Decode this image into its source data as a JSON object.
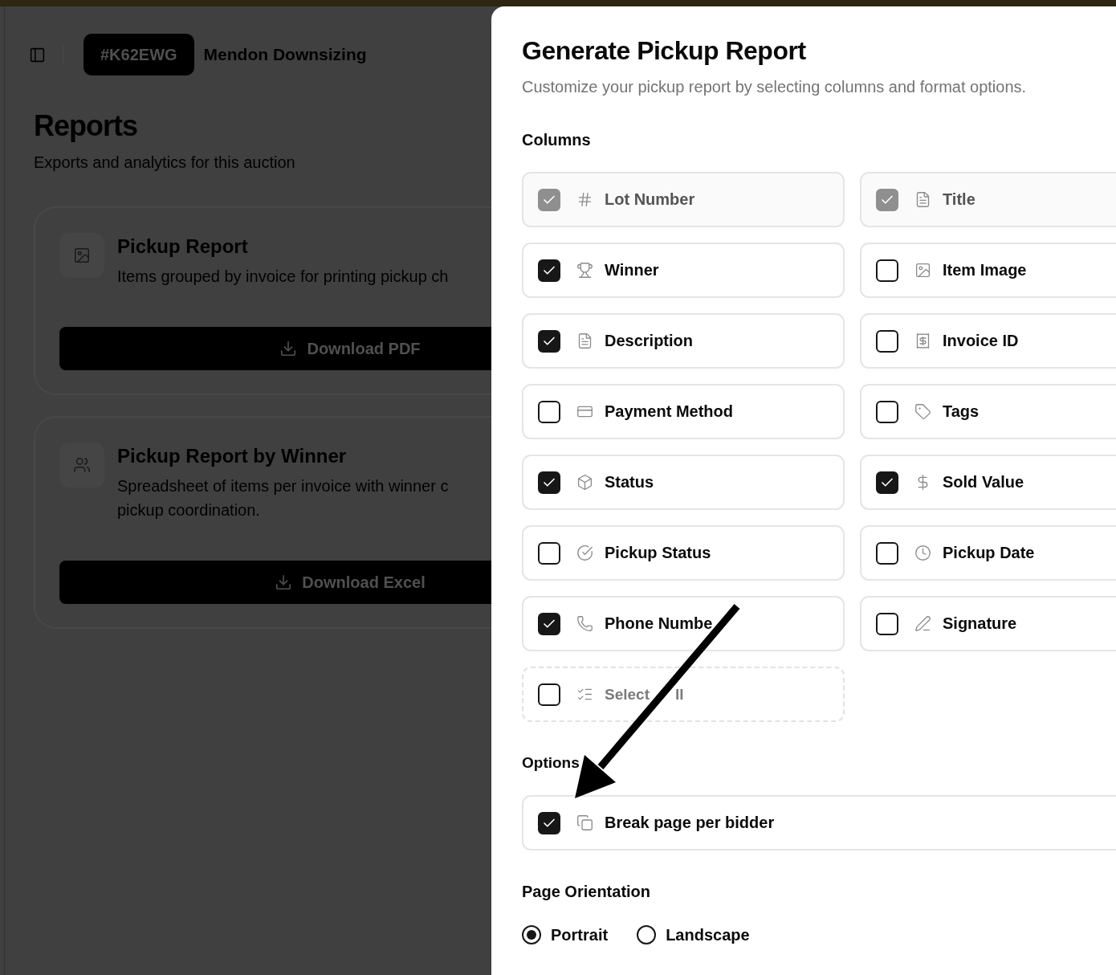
{
  "header": {
    "auction_code": "#K62EWG",
    "auction_name": "Mendon Downsizing"
  },
  "page": {
    "title": "Reports",
    "subtitle": "Exports and analytics for this auction"
  },
  "report_cards": [
    {
      "title": "Pickup Report",
      "description_lines": [
        "Items grouped by invoice for printing pickup ch"
      ],
      "button": "Download PDF"
    },
    {
      "title": "Pickup Report by Winner",
      "description_lines": [
        "Spreadsheet of items per invoice with winner c",
        "pickup coordination."
      ],
      "button": "Download Excel"
    }
  ],
  "dialog": {
    "title": "Generate Pickup Report",
    "subtitle": "Customize your pickup report by selecting columns and format options.",
    "columns_heading": "Columns",
    "columns": [
      {
        "label": "Lot Number",
        "checked": true,
        "disabled": true
      },
      {
        "label": "Title",
        "checked": true,
        "disabled": true
      },
      {
        "label": "Winner",
        "checked": true,
        "disabled": false
      },
      {
        "label": "Item Image",
        "checked": false,
        "disabled": false
      },
      {
        "label": "Description",
        "checked": true,
        "disabled": false
      },
      {
        "label": "Invoice ID",
        "checked": false,
        "disabled": false
      },
      {
        "label": "Payment Method",
        "checked": false,
        "disabled": false
      },
      {
        "label": "Tags",
        "checked": false,
        "disabled": false
      },
      {
        "label": "Status",
        "checked": true,
        "disabled": false
      },
      {
        "label": "Sold Value",
        "checked": true,
        "disabled": false
      },
      {
        "label": "Pickup Status",
        "checked": false,
        "disabled": false
      },
      {
        "label": "Pickup Date",
        "checked": false,
        "disabled": false
      },
      {
        "label": "Phone Numbe",
        "checked": true,
        "disabled": false
      },
      {
        "label": "Signature",
        "checked": false,
        "disabled": false
      }
    ],
    "select_all": {
      "label_pieces": [
        "Select",
        "ll"
      ],
      "checked": false
    },
    "options_heading": "Options",
    "options": [
      {
        "label": "Break page per bidder",
        "checked": true
      }
    ],
    "orientation_heading": "Page Orientation",
    "orientations": [
      {
        "label": "Portrait",
        "selected": true
      },
      {
        "label": "Landscape",
        "selected": false
      }
    ]
  }
}
